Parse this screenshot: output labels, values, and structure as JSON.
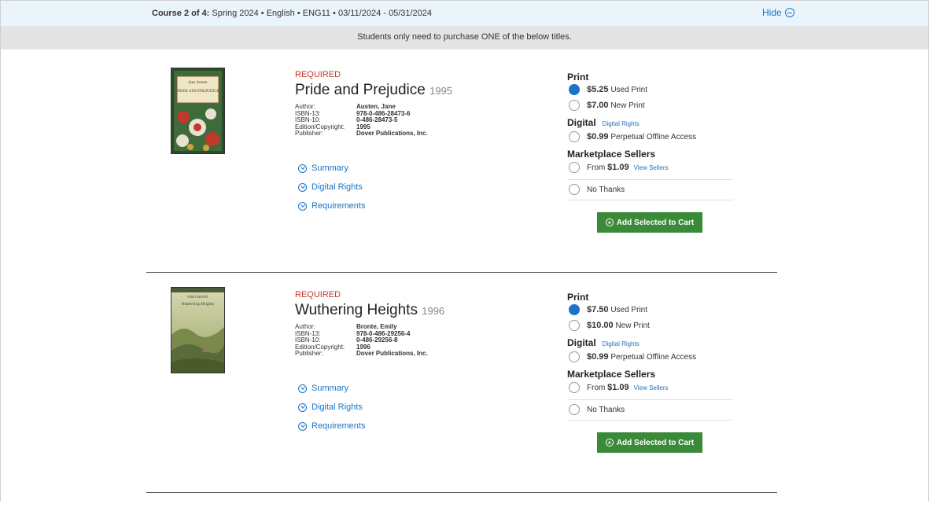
{
  "course": {
    "prefix": "Course 2 of 4:",
    "details": " Spring 2024  •  English  •  ENG11 •  03/11/2024 - 05/31/2024",
    "hide_label": "Hide"
  },
  "notice": "Students only need to purchase ONE of the below titles.",
  "labels": {
    "author": "Author:",
    "isbn13": "ISBN-13:",
    "isbn10": "ISBN-10:",
    "edition": "Edition/Copyright:",
    "publisher": "Publisher:",
    "summary": "Summary",
    "digital_rights": "Digital Rights",
    "requirements": "Requirements",
    "print": "Print",
    "digital": "Digital",
    "digital_rights_link": "Digital Rights",
    "marketplace": "Marketplace Sellers",
    "from": "From",
    "view_sellers": "View Sellers",
    "no_thanks": "No Thanks",
    "add_to_cart": "Add Selected to Cart"
  },
  "books": [
    {
      "status": "REQUIRED",
      "title": "Pride and Prejudice",
      "year": "1995",
      "author": "Austen, Jane",
      "isbn13": "978-0-486-28473-6",
      "isbn10": "0-486-28473-5",
      "edition": "1995",
      "publisher": "Dover Publications, Inc.",
      "cover_top_text": "Jane Austen",
      "cover_title": "PRIDE AND PREJUDICE",
      "used_price": "$5.25",
      "used_label": "Used Print",
      "new_price": "$7.00",
      "new_label": "New Print",
      "digital_price": "$0.99",
      "digital_label": "Perpetual Offline Access",
      "market_price": "$1.09",
      "selected_option": "used"
    },
    {
      "status": "REQUIRED",
      "title": "Wuthering Heights",
      "year": "1996",
      "author": "Bronte, Emily",
      "isbn13": "978-0-486-29256-4",
      "isbn10": "0-486-29256-8",
      "edition": "1996",
      "publisher": "Dover Publications, Inc.",
      "cover_top_text": "EMILY BRONTË",
      "cover_title": "Wuthering Heights",
      "used_price": "$7.50",
      "used_label": "Used Print",
      "new_price": "$10.00",
      "new_label": "New Print",
      "digital_price": "$0.99",
      "digital_label": "Perpetual Offline Access",
      "market_price": "$1.09",
      "selected_option": "used"
    }
  ],
  "colors": {
    "link": "#1a73c4",
    "required": "#c0392b",
    "cart_button": "#3a8a3a",
    "course_bar": "#eaf5fb",
    "notice_bar": "#e4e4e4"
  }
}
